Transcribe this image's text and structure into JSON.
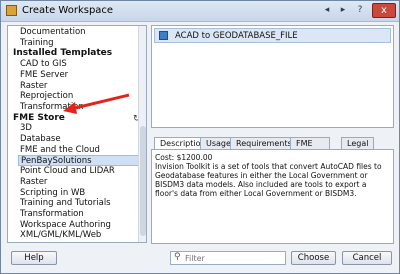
{
  "window": {
    "title": "Create Workspace"
  },
  "titlebar": {
    "back_icon": "◂",
    "forward_icon": "▸",
    "help_icon": "?",
    "close_icon": "x"
  },
  "tree": {
    "rows": [
      {
        "type": "item",
        "label": "Documentation"
      },
      {
        "type": "item",
        "label": "Training"
      },
      {
        "type": "head",
        "label": "Installed Templates"
      },
      {
        "type": "item",
        "label": "CAD to GIS"
      },
      {
        "type": "item",
        "label": "FME Server"
      },
      {
        "type": "item",
        "label": "Raster"
      },
      {
        "type": "item",
        "label": "Reprojection"
      },
      {
        "type": "item",
        "label": "Transformation"
      },
      {
        "type": "head",
        "label": "FME Store"
      },
      {
        "type": "item",
        "label": "3D"
      },
      {
        "type": "item",
        "label": "Database"
      },
      {
        "type": "item",
        "label": "FME and the Cloud"
      },
      {
        "type": "item",
        "label": "PenBaySolutions",
        "selected": true
      },
      {
        "type": "item",
        "label": "Point Cloud and LIDAR"
      },
      {
        "type": "item",
        "label": "Raster"
      },
      {
        "type": "item",
        "label": "Scripting in WB"
      },
      {
        "type": "item",
        "label": "Training and Tutorials"
      },
      {
        "type": "item",
        "label": "Transformation"
      },
      {
        "type": "item",
        "label": "Workspace Authoring"
      },
      {
        "type": "item",
        "label": "XML/GML/KML/Web"
      }
    ],
    "refresh_icon": "↻"
  },
  "template": {
    "name": "ACAD to GEODATABASE_FILE"
  },
  "tabs": [
    "Description",
    "Usage",
    "Requirements",
    "FME History",
    "Legal"
  ],
  "description": "Cost: $1200.00\nInvision Toolkit is a set of tools that convert AutoCAD files to Geodatabase features in either the Local Government or BISDM3 data models. Also included are tools to export a floor's data from either Local Government or BISDM3.",
  "footer": {
    "help_label": "Help",
    "filter_placeholder": "Filter",
    "choose_label": "Choose",
    "cancel_label": "Cancel"
  }
}
